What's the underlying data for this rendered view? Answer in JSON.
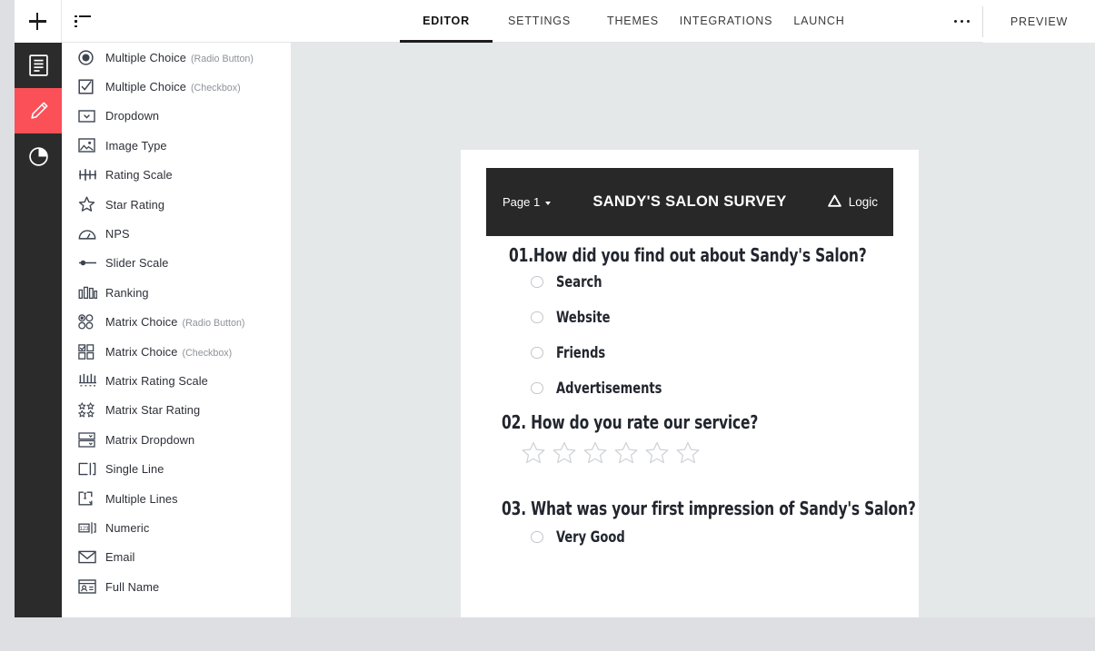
{
  "topbar": {
    "add_icon": "plus-icon",
    "list_icon": "list-view-icon",
    "tabs": [
      {
        "label": "EDITOR",
        "active": true
      },
      {
        "label": "SETTINGS",
        "active": false
      },
      {
        "label": "THEMES",
        "active": false
      },
      {
        "label": "INTEGRATIONS",
        "active": false
      },
      {
        "label": "LAUNCH",
        "active": false
      }
    ],
    "more_icon": "more-horizontal-icon",
    "preview_label": "PREVIEW"
  },
  "rail": {
    "items": [
      {
        "icon": "document-icon",
        "active": false
      },
      {
        "icon": "pencil-icon",
        "active": true
      },
      {
        "icon": "pie-chart-icon",
        "active": false
      }
    ],
    "active_color": "#fb5058",
    "background": "#2b2b2b"
  },
  "question_types": [
    {
      "icon": "radio-button-icon",
      "label": "Multiple Choice",
      "sub": "(Radio Button)"
    },
    {
      "icon": "checkbox-icon",
      "label": "Multiple Choice",
      "sub": "(Checkbox)"
    },
    {
      "icon": "dropdown-icon",
      "label": "Dropdown",
      "sub": ""
    },
    {
      "icon": "image-icon",
      "label": "Image Type",
      "sub": ""
    },
    {
      "icon": "rating-scale-icon",
      "label": "Rating Scale",
      "sub": ""
    },
    {
      "icon": "star-icon",
      "label": "Star Rating",
      "sub": ""
    },
    {
      "icon": "nps-gauge-icon",
      "label": "NPS",
      "sub": ""
    },
    {
      "icon": "slider-icon",
      "label": "Slider Scale",
      "sub": ""
    },
    {
      "icon": "ranking-bars-icon",
      "label": "Ranking",
      "sub": ""
    },
    {
      "icon": "matrix-radio-icon",
      "label": "Matrix Choice",
      "sub": "(Radio Button)"
    },
    {
      "icon": "matrix-checkbox-icon",
      "label": "Matrix Choice",
      "sub": "(Checkbox)"
    },
    {
      "icon": "matrix-rating-scale-icon",
      "label": "Matrix Rating Scale",
      "sub": ""
    },
    {
      "icon": "matrix-star-icon",
      "label": "Matrix Star Rating",
      "sub": ""
    },
    {
      "icon": "matrix-dropdown-icon",
      "label": "Matrix Dropdown",
      "sub": ""
    },
    {
      "icon": "single-line-icon",
      "label": "Single Line",
      "sub": ""
    },
    {
      "icon": "multiple-lines-icon",
      "label": "Multiple Lines",
      "sub": ""
    },
    {
      "icon": "numeric-icon",
      "label": "Numeric",
      "sub": ""
    },
    {
      "icon": "email-icon",
      "label": "Email",
      "sub": ""
    },
    {
      "icon": "full-name-icon",
      "label": "Full Name",
      "sub": ""
    }
  ],
  "survey": {
    "page_selector": "Page 1",
    "title": "SANDY'S SALON SURVEY",
    "logic_label": "Logic",
    "logic_icon": "logic-triangle-icon",
    "questions": [
      {
        "number": "01.",
        "text": "01.How did you find out about Sandy's Salon?",
        "type": "radio",
        "options": [
          "Search",
          "Website",
          "Friends",
          "Advertisements"
        ]
      },
      {
        "number": "02.",
        "text": "02. How do you rate our service?",
        "type": "star",
        "star_count": 6
      },
      {
        "number": "03.",
        "text": "03. What was your first impression of Sandy's Salon?",
        "type": "radio",
        "options": [
          "Very Good"
        ]
      }
    ]
  }
}
